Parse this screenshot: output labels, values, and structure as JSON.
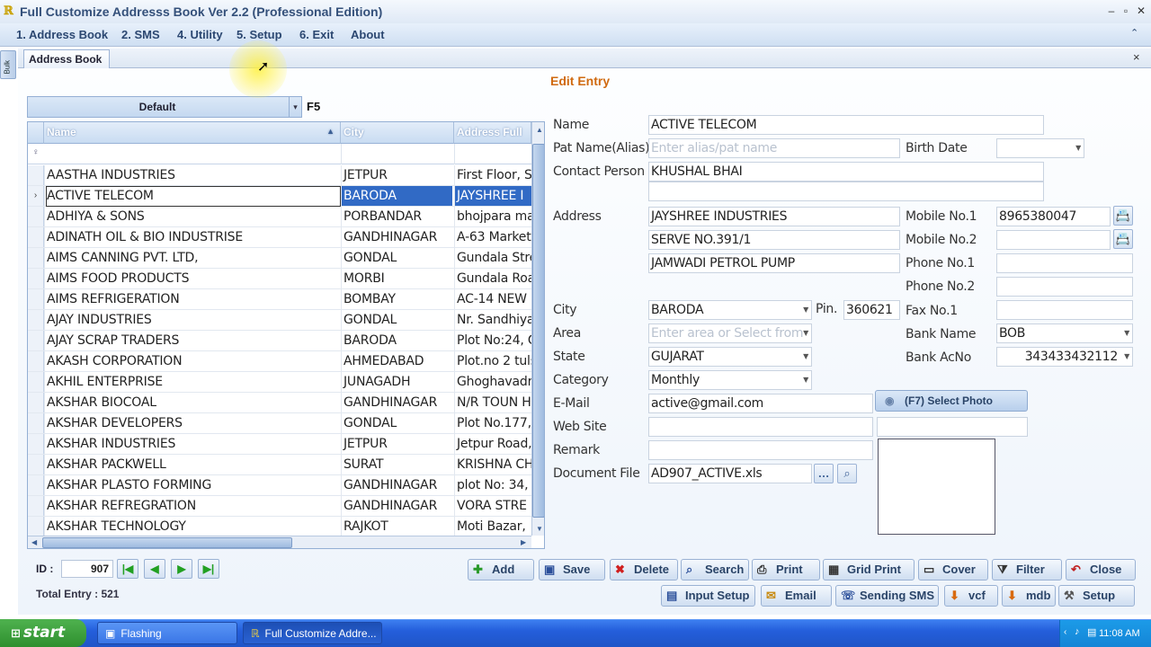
{
  "window": {
    "title": "Full Customize Addresss Book Ver 2.2 (Professional Edition)",
    "icon": "app-logo-icon"
  },
  "menu": [
    "1. Address Book",
    "2. SMS",
    "4. Utility",
    "5. Setup",
    "6. Exit",
    "About"
  ],
  "side_tab": "Bulk",
  "doc_tab": "Address Book",
  "heading": "Edit Entry",
  "group": {
    "value": "Default",
    "hotkey": "F5"
  },
  "grid": {
    "columns": [
      "Name",
      "City",
      "Address Full"
    ],
    "rows": [
      [
        "AASTHA INDUSTRIES",
        "JETPUR",
        "First Floor, S"
      ],
      [
        "ACTIVE TELECOM",
        "BARODA",
        "JAYSHREE I"
      ],
      [
        "ADHIYA & SONS",
        "PORBANDAR",
        "bhojpara mai"
      ],
      [
        "ADINATH OIL & BIO INDUSTRISE",
        "GANDHINAGAR",
        "A-63  Marketi"
      ],
      [
        "AIMS CANNING PVT. LTD,",
        "GONDAL",
        "Gundala Stre"
      ],
      [
        "AIMS FOOD PRODUCTS",
        "MORBI",
        "Gundala Roa"
      ],
      [
        "AIMS REFRIGERATION",
        "BOMBAY",
        "AC-14 NEW"
      ],
      [
        "AJAY INDUSTRIES",
        "GONDAL",
        "Nr. Sandhiya"
      ],
      [
        "AJAY SCRAP TRADERS",
        "BARODA",
        "Plot No:24, G"
      ],
      [
        "AKASH CORPORATION",
        "AHMEDABAD",
        "Plot.no 2 tuls"
      ],
      [
        "AKHIL ENTERPRISE",
        "JUNAGADH",
        "Ghoghavadra"
      ],
      [
        "AKSHAR BIOCOAL",
        "GANDHINAGAR",
        "N/R TOUN H"
      ],
      [
        "AKSHAR DEVELOPERS",
        "GONDAL",
        "Plot No.177,"
      ],
      [
        "AKSHAR INDUSTRIES",
        "JETPUR",
        "Jetpur Road,"
      ],
      [
        "AKSHAR PACKWELL",
        "SURAT",
        "KRISHNA CH"
      ],
      [
        "AKSHAR PLASTO FORMING",
        "GANDHINAGAR",
        "plot No: 34, G"
      ],
      [
        "AKSHAR REFREGRATION",
        "GANDHINAGAR",
        "VORA STRE"
      ],
      [
        "AKSHAR TECHNOLOGY",
        "RAJKOT",
        "Moti Bazar,"
      ]
    ],
    "selected_index": 1
  },
  "form": {
    "labels": {
      "name": "Name",
      "alias": "Pat Name(Alias)",
      "birth": "Birth Date",
      "contact": "Contact Person",
      "address": "Address",
      "mobile1": "Mobile No.1",
      "mobile2": "Mobile No.2",
      "phone1": "Phone No.1",
      "phone2": "Phone No.2",
      "city": "City",
      "pin": "Pin.",
      "fax": "Fax No.1",
      "area": "Area",
      "bank": "Bank Name",
      "state": "State",
      "bankac": "Bank AcNo",
      "category": "Category",
      "email": "E-Mail",
      "website": "Web Site",
      "remark": "Remark",
      "docfile": "Document File"
    },
    "name": "ACTIVE TELECOM",
    "alias_placeholder": "Enter alias/pat name",
    "contact": "KHUSHAL BHAI",
    "address1": "JAYSHREE INDUSTRIES",
    "address2": "SERVE NO.391/1",
    "address3": "JAMWADI PETROL PUMP",
    "mobile1": "8965380047",
    "city": "BARODA",
    "pin": "360621",
    "area_placeholder": "Enter area or Select from",
    "bank_name": "BOB",
    "state": "GUJARAT",
    "bank_acno": "343433432112",
    "category": "Monthly",
    "email": "active@gmail.com",
    "select_photo": "(F7) Select Photo",
    "document_file": "AD907_ACTIVE.xls"
  },
  "nav": {
    "id_label": "ID :",
    "id_value": "907",
    "total": "Total Entry : 521"
  },
  "actions_row1": [
    {
      "label": "Add",
      "icon": "plus-icon",
      "color": "#2a9a2a"
    },
    {
      "label": "Save",
      "icon": "floppy-icon",
      "color": "#2b4f9a"
    },
    {
      "label": "Delete",
      "icon": "x-icon",
      "color": "#d02020"
    },
    {
      "label": "Search",
      "icon": "magnifier-icon",
      "color": "#2b4f9a"
    },
    {
      "label": "Print",
      "icon": "printer-icon",
      "color": "#333"
    },
    {
      "label": "Grid Print",
      "icon": "grid-print-icon",
      "color": "#333"
    },
    {
      "label": "Cover",
      "icon": "cover-icon",
      "color": "#333"
    },
    {
      "label": "Filter",
      "icon": "filter-icon",
      "color": "#333"
    },
    {
      "label": "Close",
      "icon": "undo-icon",
      "color": "#c02020"
    }
  ],
  "actions_row2": [
    {
      "label": "Input Setup",
      "icon": "form-icon",
      "color": "#2b4f9a"
    },
    {
      "label": "Email",
      "icon": "envelope-icon",
      "color": "#c88a10"
    },
    {
      "label": "Sending SMS",
      "icon": "phone-icon",
      "color": "#2b4f9a"
    },
    {
      "label": "vcf",
      "icon": "export-icon",
      "color": "#d86a10"
    },
    {
      "label": "mdb",
      "icon": "export-icon",
      "color": "#d86a10"
    },
    {
      "label": "Setup",
      "icon": "tools-icon",
      "color": "#555"
    }
  ],
  "taskbar": {
    "start": "start",
    "items": [
      "Flashing",
      "Full Customize Addre..."
    ],
    "clock": "11:08 AM"
  }
}
